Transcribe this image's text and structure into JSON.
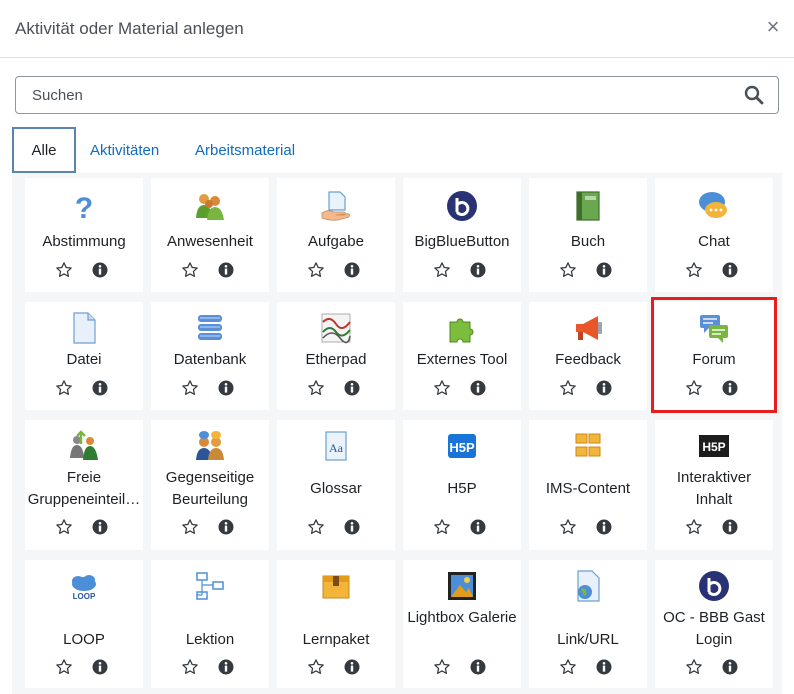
{
  "dialog": {
    "title": "Aktivität oder Material anlegen",
    "close_label": "×"
  },
  "search": {
    "placeholder": "Suchen"
  },
  "tabs": [
    {
      "label": "Alle",
      "active": true
    },
    {
      "label": "Aktivitäten",
      "active": false
    },
    {
      "label": "Arbeitsmaterial",
      "active": false
    }
  ],
  "modules": [
    {
      "name": "Abstimmung",
      "icon": "question-icon"
    },
    {
      "name": "Anwesenheit",
      "icon": "attendance-people-icon"
    },
    {
      "name": "Aufgabe",
      "icon": "assignment-hand-icon"
    },
    {
      "name": "BigBlueButton",
      "icon": "bigbluebutton-icon"
    },
    {
      "name": "Buch",
      "icon": "book-icon"
    },
    {
      "name": "Chat",
      "icon": "chat-bubbles-icon"
    },
    {
      "name": "Datei",
      "icon": "file-icon"
    },
    {
      "name": "Datenbank",
      "icon": "database-icon"
    },
    {
      "name": "Etherpad",
      "icon": "etherpad-icon"
    },
    {
      "name": "Externes Tool",
      "icon": "puzzle-icon"
    },
    {
      "name": "Feedback",
      "icon": "megaphone-icon"
    },
    {
      "name": "Forum",
      "icon": "forum-bubbles-icon"
    },
    {
      "name": "Freie Gruppeneinteil…",
      "icon": "group-choice-icon"
    },
    {
      "name": "Gegenseitige Beurteilung",
      "icon": "workshop-icon"
    },
    {
      "name": "Glossar",
      "icon": "glossary-icon"
    },
    {
      "name": "H5P",
      "icon": "h5p-icon"
    },
    {
      "name": "IMS-Content",
      "icon": "ims-boxes-icon"
    },
    {
      "name": "Interaktiver Inhalt",
      "icon": "h5p-dark-icon"
    },
    {
      "name": "LOOP",
      "icon": "loop-cloud-icon"
    },
    {
      "name": "Lektion",
      "icon": "lesson-icon"
    },
    {
      "name": "Lernpaket",
      "icon": "package-icon"
    },
    {
      "name": "Lightbox Galerie",
      "icon": "gallery-icon"
    },
    {
      "name": "Link/URL",
      "icon": "url-icon"
    },
    {
      "name": "OC - BBB Gast Login",
      "icon": "bigbluebutton-guest-icon"
    }
  ],
  "colors": {
    "accent": "#0f6cbf",
    "highlight": "#e61e1e"
  }
}
